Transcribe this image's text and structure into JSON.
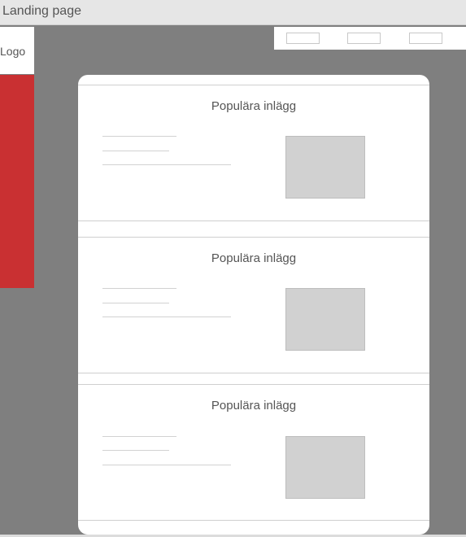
{
  "window": {
    "title": "Landing page"
  },
  "logo": {
    "label": "Logo"
  },
  "colors": {
    "background": "#7f7f7f",
    "sidebar_accent": "#c93032",
    "card": "#ffffff",
    "placeholder": "#d1d1d1"
  },
  "nav": {
    "items": [
      {
        "icon": "nav-button-placeholder"
      },
      {
        "icon": "nav-button-placeholder"
      },
      {
        "icon": "nav-button-placeholder"
      }
    ]
  },
  "posts": [
    {
      "title": "Populära inlägg",
      "thumbnail": "image-placeholder"
    },
    {
      "title": "Populära inlägg",
      "thumbnail": "image-placeholder"
    },
    {
      "title": "Populära inlägg",
      "thumbnail": "image-placeholder"
    }
  ]
}
